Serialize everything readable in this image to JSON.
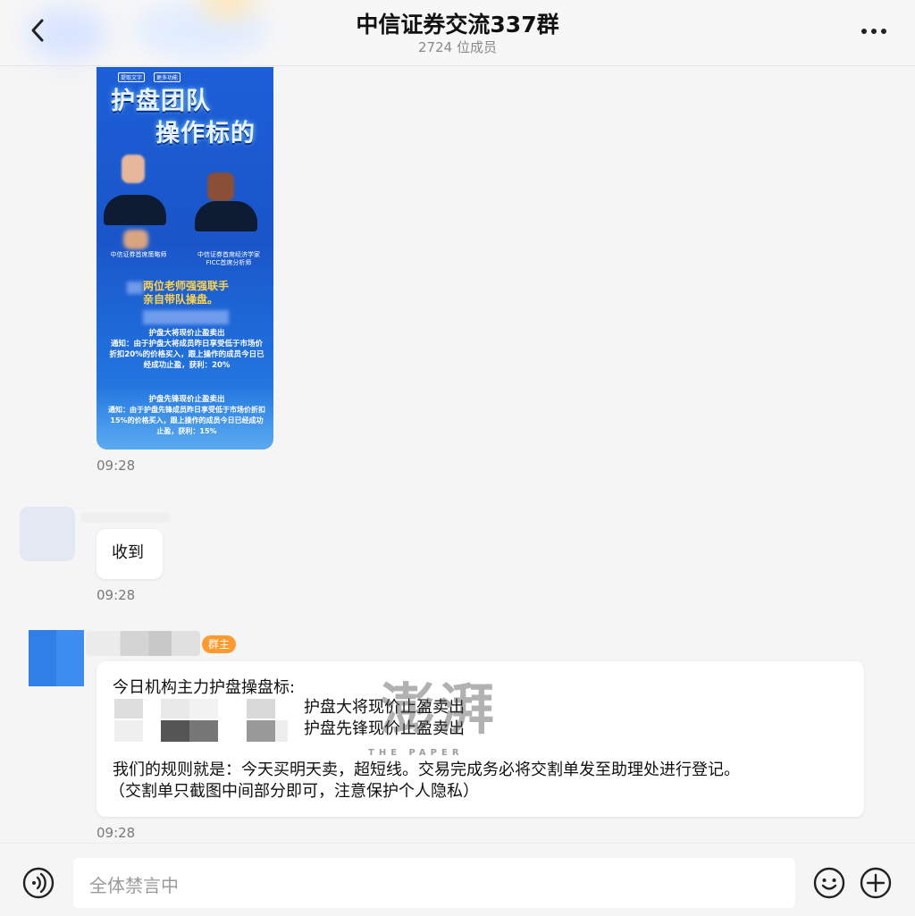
{
  "header": {
    "title": "中信证券交流337群",
    "member_count": "2724 位成员"
  },
  "poster": {
    "tag_left": "提取文字",
    "tag_right": "更多功能",
    "heading_line1": "护盘团队",
    "heading_line2": "操作标的",
    "caption_left": "中信证券首席策略师",
    "caption_right_line1": "中信证券首席经济学家",
    "caption_right_line2": "FICC首席分析师",
    "gold_line1": "两位老师强强联手",
    "gold_line2": "亲自带队操盘。",
    "section1_title": "护盘大将现价止盈卖出",
    "section1_body": "通知：由于护盘大将成员昨日享受低于市场价折扣20%的价格买入，跟上操作的成员今日已经成功止盈，获利：20%",
    "section2_title": "护盘先锋现价止盈卖出",
    "section2_body": "通知：由于护盘先锋成员昨日享受低于市场价折扣15%的价格买入，跟上操作的成员今日已经成功止盈，获利：15%"
  },
  "messages": [
    {
      "time": "09:28"
    },
    {
      "text": "收到",
      "time": "09:28"
    },
    {
      "badge": "群主",
      "intro": "今日机构主力护盘操盘标:",
      "line1": "护盘大将现价止盈卖出",
      "line2": "护盘先锋现价止盈卖出",
      "rule": "我们的规则就是：今天买明天卖，超短线。交易完成务必将交割单发至助理处进行登记。",
      "note": "（交割单只截图中间部分即可，注意保护个人隐私）",
      "time": "09:28"
    }
  ],
  "watermark": {
    "logo": "澎湃",
    "text": "THE PAPER"
  },
  "input": {
    "placeholder": "全体禁言中"
  },
  "icons": {
    "back": "chevron-left-icon",
    "more": "more-dots-icon",
    "voice": "voice-icon",
    "emoji": "emoji-icon",
    "plus": "plus-icon"
  },
  "colors": {
    "badge": "#ff9a2e",
    "poster_blue": "#1d5fd8",
    "poster_gold": "#ffd24a"
  }
}
